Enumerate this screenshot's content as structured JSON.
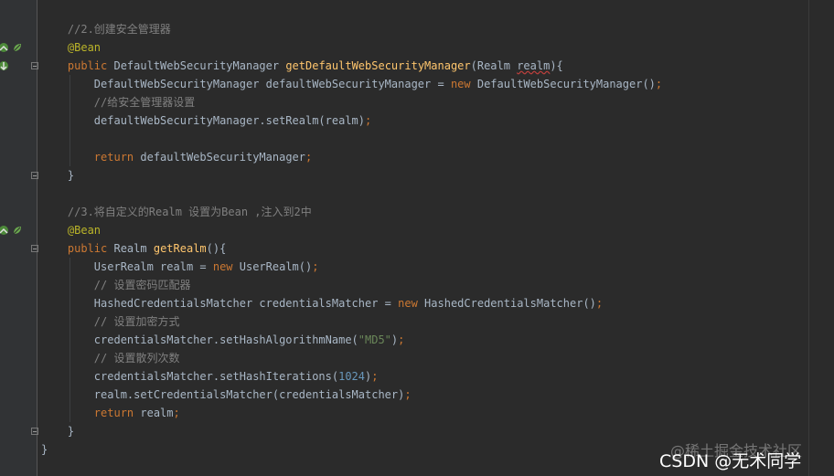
{
  "code": {
    "lines": [
      {
        "indent": "    ",
        "tokens": [
          {
            "t": "//2.创建安全管理器",
            "c": "cm"
          }
        ]
      },
      {
        "indent": "    ",
        "tokens": [
          {
            "t": "@Bean",
            "c": "ann"
          }
        ]
      },
      {
        "indent": "    ",
        "tokens": [
          {
            "t": "public ",
            "c": "kw"
          },
          {
            "t": "DefaultWebSecurityManager ",
            "c": ""
          },
          {
            "t": "getDefaultWebSecurityManager",
            "c": "fn"
          },
          {
            "t": "(Realm ",
            "c": ""
          },
          {
            "t": "realm",
            "c": "warn"
          },
          {
            "t": "){",
            "c": ""
          }
        ]
      },
      {
        "indent": "        ",
        "tokens": [
          {
            "t": "DefaultWebSecurityManager defaultWebSecurityManager = ",
            "c": ""
          },
          {
            "t": "new ",
            "c": "kw"
          },
          {
            "t": "DefaultWebSecurityManager()",
            "c": ""
          },
          {
            "t": ";",
            "c": "kw"
          }
        ]
      },
      {
        "indent": "        ",
        "tokens": [
          {
            "t": "//给安全管理器设置",
            "c": "cm"
          }
        ]
      },
      {
        "indent": "        ",
        "tokens": [
          {
            "t": "defaultWebSecurityManager.setRealm(realm)",
            "c": ""
          },
          {
            "t": ";",
            "c": "kw"
          }
        ]
      },
      {
        "indent": "",
        "tokens": []
      },
      {
        "indent": "        ",
        "tokens": [
          {
            "t": "return ",
            "c": "kw"
          },
          {
            "t": "defaultWebSecurityManager",
            "c": ""
          },
          {
            "t": ";",
            "c": "kw"
          }
        ]
      },
      {
        "indent": "    ",
        "tokens": [
          {
            "t": "}",
            "c": ""
          }
        ]
      },
      {
        "indent": "",
        "tokens": []
      },
      {
        "indent": "    ",
        "tokens": [
          {
            "t": "//3.将自定义的Realm 设置为Bean ,注入到2中",
            "c": "cm"
          }
        ]
      },
      {
        "indent": "    ",
        "tokens": [
          {
            "t": "@Bean",
            "c": "ann"
          }
        ]
      },
      {
        "indent": "    ",
        "tokens": [
          {
            "t": "public ",
            "c": "kw"
          },
          {
            "t": "Realm ",
            "c": ""
          },
          {
            "t": "getRealm",
            "c": "fn"
          },
          {
            "t": "(){",
            "c": ""
          }
        ]
      },
      {
        "indent": "        ",
        "tokens": [
          {
            "t": "UserRealm realm = ",
            "c": ""
          },
          {
            "t": "new ",
            "c": "kw"
          },
          {
            "t": "UserRealm()",
            "c": ""
          },
          {
            "t": ";",
            "c": "kw"
          }
        ]
      },
      {
        "indent": "        ",
        "tokens": [
          {
            "t": "// 设置密码匹配器",
            "c": "cm"
          }
        ]
      },
      {
        "indent": "        ",
        "tokens": [
          {
            "t": "HashedCredentialsMatcher credentialsMatcher = ",
            "c": ""
          },
          {
            "t": "new ",
            "c": "kw"
          },
          {
            "t": "HashedCredentialsMatcher()",
            "c": ""
          },
          {
            "t": ";",
            "c": "kw"
          }
        ]
      },
      {
        "indent": "        ",
        "tokens": [
          {
            "t": "// 设置加密方式",
            "c": "cm"
          }
        ]
      },
      {
        "indent": "        ",
        "tokens": [
          {
            "t": "credentialsMatcher.setHashAlgorithmName(",
            "c": ""
          },
          {
            "t": "\"MD5\"",
            "c": "str"
          },
          {
            "t": ")",
            "c": ""
          },
          {
            "t": ";",
            "c": "kw"
          }
        ]
      },
      {
        "indent": "        ",
        "tokens": [
          {
            "t": "// 设置散列次数",
            "c": "cm"
          }
        ]
      },
      {
        "indent": "        ",
        "tokens": [
          {
            "t": "credentialsMatcher.setHashIterations(",
            "c": ""
          },
          {
            "t": "1024",
            "c": "num"
          },
          {
            "t": ")",
            "c": ""
          },
          {
            "t": ";",
            "c": "kw"
          }
        ]
      },
      {
        "indent": "        ",
        "tokens": [
          {
            "t": "realm.setCredentialsMatcher(credentialsMatcher)",
            "c": ""
          },
          {
            "t": ";",
            "c": "kw"
          }
        ]
      },
      {
        "indent": "        ",
        "tokens": [
          {
            "t": "return ",
            "c": "kw"
          },
          {
            "t": "realm",
            "c": ""
          },
          {
            "t": ";",
            "c": "kw"
          }
        ]
      },
      {
        "indent": "    ",
        "tokens": [
          {
            "t": "}",
            "c": ""
          }
        ]
      },
      {
        "indent": "",
        "tokens": [
          {
            "t": "}",
            "c": ""
          }
        ]
      }
    ]
  },
  "gutter": {
    "bean_markers": [
      {
        "line": 1,
        "icons": [
          "bean-run-icon",
          "bean-leaf-icon"
        ]
      },
      {
        "line": 11,
        "icons": [
          "bean-run-icon",
          "bean-leaf-icon"
        ]
      }
    ],
    "override_marker_line": 2,
    "fold_lines": [
      2,
      8,
      12,
      22
    ]
  },
  "watermark": {
    "text": "@稀土掘金技术社区"
  },
  "footer": {
    "text": "CSDN @无术同学"
  },
  "colors": {
    "background": "#2b2b2b",
    "keyword": "#cc7832",
    "annotation": "#bbb529",
    "method": "#ffc66d",
    "comment": "#808080",
    "string": "#6a8759",
    "number": "#6897bb",
    "default_text": "#a9b7c6"
  }
}
